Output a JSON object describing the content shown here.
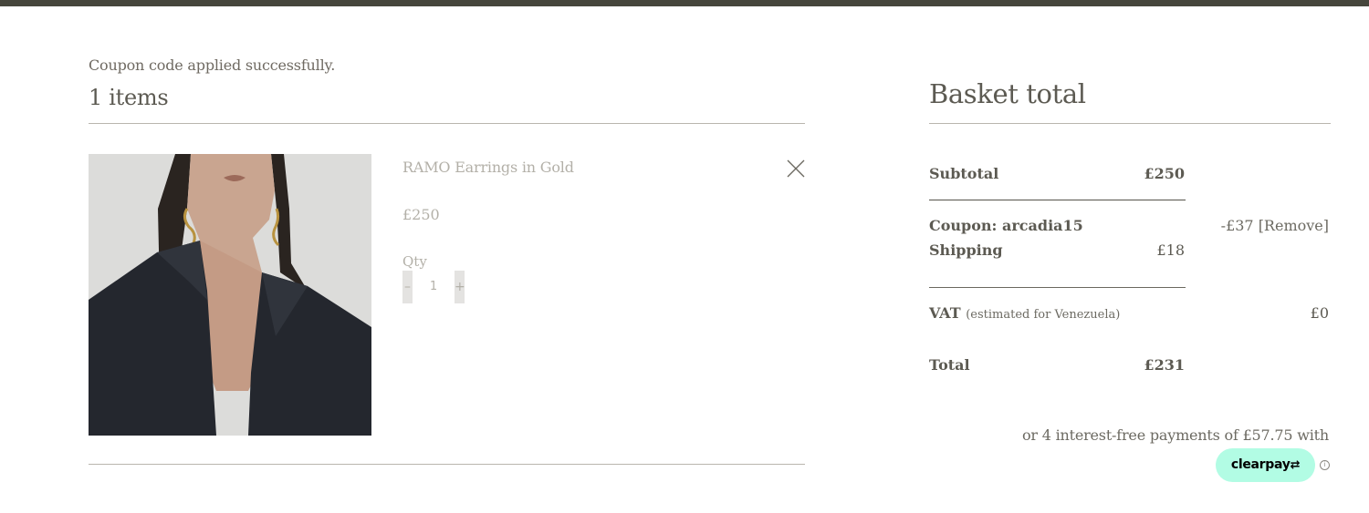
{
  "notice": "Coupon code applied successfully.",
  "cart": {
    "items_count_label": "1 items",
    "items": [
      {
        "name": "RAMO Earrings in Gold",
        "price": "£250",
        "qty_label": "Qty",
        "qty_minus": "–",
        "qty": "1",
        "qty_plus": "+"
      }
    ]
  },
  "basket": {
    "title": "Basket total",
    "subtotal_label": "Subtotal",
    "subtotal_value": "£250",
    "coupon_label": "Coupon: arcadia15",
    "coupon_value": "-£37 [Remove]",
    "shipping_label": "Shipping",
    "shipping_value": "£18",
    "vat_label": "VAT",
    "vat_note": "(estimated for Venezuela)",
    "vat_value": "£0",
    "total_label": "Total",
    "total_value": "£231",
    "installments_text": "or 4 interest-free payments of £57.75 with",
    "clearpay_label": "clearpay"
  },
  "icons": {
    "remove_item": "close-icon",
    "info": "info-icon",
    "clearpay_logo": "clearpay-arrows-icon"
  },
  "colors": {
    "top_bar": "#46463c",
    "clearpay_mint": "#b2fce4",
    "text": "#5c5a52",
    "muted_text": "#b3b0a8"
  }
}
